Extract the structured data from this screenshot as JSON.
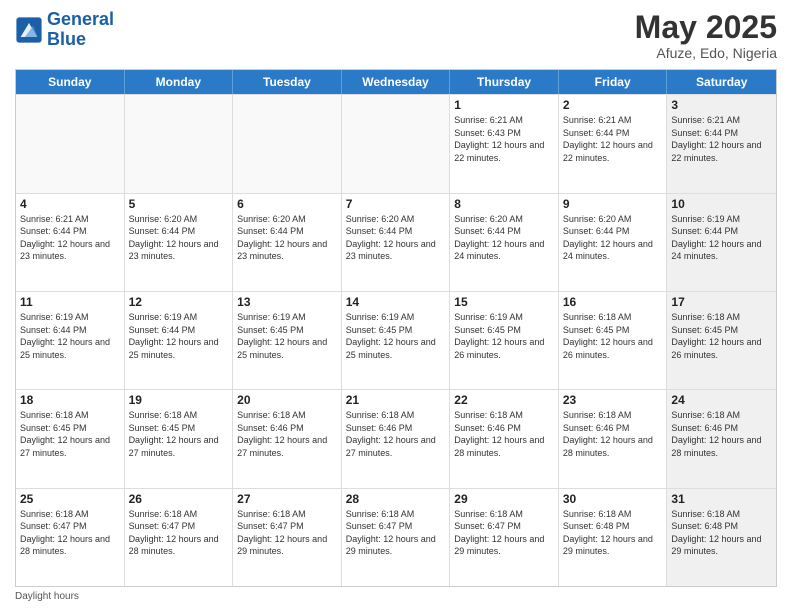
{
  "header": {
    "logo_line1": "General",
    "logo_line2": "Blue",
    "main_title": "May 2025",
    "subtitle": "Afuze, Edo, Nigeria"
  },
  "calendar": {
    "days_of_week": [
      "Sunday",
      "Monday",
      "Tuesday",
      "Wednesday",
      "Thursday",
      "Friday",
      "Saturday"
    ],
    "weeks": [
      [
        {
          "day": "",
          "empty": true
        },
        {
          "day": "",
          "empty": true
        },
        {
          "day": "",
          "empty": true
        },
        {
          "day": "",
          "empty": true
        },
        {
          "day": "1",
          "sunrise": "Sunrise: 6:21 AM",
          "sunset": "Sunset: 6:43 PM",
          "daylight": "Daylight: 12 hours and 22 minutes."
        },
        {
          "day": "2",
          "sunrise": "Sunrise: 6:21 AM",
          "sunset": "Sunset: 6:44 PM",
          "daylight": "Daylight: 12 hours and 22 minutes."
        },
        {
          "day": "3",
          "sunrise": "Sunrise: 6:21 AM",
          "sunset": "Sunset: 6:44 PM",
          "daylight": "Daylight: 12 hours and 22 minutes.",
          "shaded": true
        }
      ],
      [
        {
          "day": "4",
          "sunrise": "Sunrise: 6:21 AM",
          "sunset": "Sunset: 6:44 PM",
          "daylight": "Daylight: 12 hours and 23 minutes."
        },
        {
          "day": "5",
          "sunrise": "Sunrise: 6:20 AM",
          "sunset": "Sunset: 6:44 PM",
          "daylight": "Daylight: 12 hours and 23 minutes."
        },
        {
          "day": "6",
          "sunrise": "Sunrise: 6:20 AM",
          "sunset": "Sunset: 6:44 PM",
          "daylight": "Daylight: 12 hours and 23 minutes."
        },
        {
          "day": "7",
          "sunrise": "Sunrise: 6:20 AM",
          "sunset": "Sunset: 6:44 PM",
          "daylight": "Daylight: 12 hours and 23 minutes."
        },
        {
          "day": "8",
          "sunrise": "Sunrise: 6:20 AM",
          "sunset": "Sunset: 6:44 PM",
          "daylight": "Daylight: 12 hours and 24 minutes."
        },
        {
          "day": "9",
          "sunrise": "Sunrise: 6:20 AM",
          "sunset": "Sunset: 6:44 PM",
          "daylight": "Daylight: 12 hours and 24 minutes."
        },
        {
          "day": "10",
          "sunrise": "Sunrise: 6:19 AM",
          "sunset": "Sunset: 6:44 PM",
          "daylight": "Daylight: 12 hours and 24 minutes.",
          "shaded": true
        }
      ],
      [
        {
          "day": "11",
          "sunrise": "Sunrise: 6:19 AM",
          "sunset": "Sunset: 6:44 PM",
          "daylight": "Daylight: 12 hours and 25 minutes."
        },
        {
          "day": "12",
          "sunrise": "Sunrise: 6:19 AM",
          "sunset": "Sunset: 6:44 PM",
          "daylight": "Daylight: 12 hours and 25 minutes."
        },
        {
          "day": "13",
          "sunrise": "Sunrise: 6:19 AM",
          "sunset": "Sunset: 6:45 PM",
          "daylight": "Daylight: 12 hours and 25 minutes."
        },
        {
          "day": "14",
          "sunrise": "Sunrise: 6:19 AM",
          "sunset": "Sunset: 6:45 PM",
          "daylight": "Daylight: 12 hours and 25 minutes."
        },
        {
          "day": "15",
          "sunrise": "Sunrise: 6:19 AM",
          "sunset": "Sunset: 6:45 PM",
          "daylight": "Daylight: 12 hours and 26 minutes."
        },
        {
          "day": "16",
          "sunrise": "Sunrise: 6:18 AM",
          "sunset": "Sunset: 6:45 PM",
          "daylight": "Daylight: 12 hours and 26 minutes."
        },
        {
          "day": "17",
          "sunrise": "Sunrise: 6:18 AM",
          "sunset": "Sunset: 6:45 PM",
          "daylight": "Daylight: 12 hours and 26 minutes.",
          "shaded": true
        }
      ],
      [
        {
          "day": "18",
          "sunrise": "Sunrise: 6:18 AM",
          "sunset": "Sunset: 6:45 PM",
          "daylight": "Daylight: 12 hours and 27 minutes."
        },
        {
          "day": "19",
          "sunrise": "Sunrise: 6:18 AM",
          "sunset": "Sunset: 6:45 PM",
          "daylight": "Daylight: 12 hours and 27 minutes."
        },
        {
          "day": "20",
          "sunrise": "Sunrise: 6:18 AM",
          "sunset": "Sunset: 6:46 PM",
          "daylight": "Daylight: 12 hours and 27 minutes."
        },
        {
          "day": "21",
          "sunrise": "Sunrise: 6:18 AM",
          "sunset": "Sunset: 6:46 PM",
          "daylight": "Daylight: 12 hours and 27 minutes."
        },
        {
          "day": "22",
          "sunrise": "Sunrise: 6:18 AM",
          "sunset": "Sunset: 6:46 PM",
          "daylight": "Daylight: 12 hours and 28 minutes."
        },
        {
          "day": "23",
          "sunrise": "Sunrise: 6:18 AM",
          "sunset": "Sunset: 6:46 PM",
          "daylight": "Daylight: 12 hours and 28 minutes."
        },
        {
          "day": "24",
          "sunrise": "Sunrise: 6:18 AM",
          "sunset": "Sunset: 6:46 PM",
          "daylight": "Daylight: 12 hours and 28 minutes.",
          "shaded": true
        }
      ],
      [
        {
          "day": "25",
          "sunrise": "Sunrise: 6:18 AM",
          "sunset": "Sunset: 6:47 PM",
          "daylight": "Daylight: 12 hours and 28 minutes."
        },
        {
          "day": "26",
          "sunrise": "Sunrise: 6:18 AM",
          "sunset": "Sunset: 6:47 PM",
          "daylight": "Daylight: 12 hours and 28 minutes."
        },
        {
          "day": "27",
          "sunrise": "Sunrise: 6:18 AM",
          "sunset": "Sunset: 6:47 PM",
          "daylight": "Daylight: 12 hours and 29 minutes."
        },
        {
          "day": "28",
          "sunrise": "Sunrise: 6:18 AM",
          "sunset": "Sunset: 6:47 PM",
          "daylight": "Daylight: 12 hours and 29 minutes."
        },
        {
          "day": "29",
          "sunrise": "Sunrise: 6:18 AM",
          "sunset": "Sunset: 6:47 PM",
          "daylight": "Daylight: 12 hours and 29 minutes."
        },
        {
          "day": "30",
          "sunrise": "Sunrise: 6:18 AM",
          "sunset": "Sunset: 6:48 PM",
          "daylight": "Daylight: 12 hours and 29 minutes."
        },
        {
          "day": "31",
          "sunrise": "Sunrise: 6:18 AM",
          "sunset": "Sunset: 6:48 PM",
          "daylight": "Daylight: 12 hours and 29 minutes.",
          "shaded": true
        }
      ]
    ],
    "footer": "Daylight hours"
  }
}
